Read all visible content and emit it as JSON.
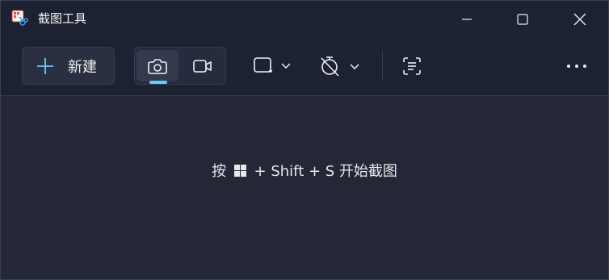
{
  "window": {
    "title": "截图工具"
  },
  "toolbar": {
    "new_label": "新建",
    "modes": [
      {
        "name": "screenshot-mode",
        "icon": "camera-icon",
        "active": true
      },
      {
        "name": "video-mode",
        "icon": "video-camera-icon",
        "active": false
      }
    ],
    "snip_shape_icon": "rectangle-snip-icon",
    "delay_icon": "timer-off-icon",
    "text_actions_icon": "text-scan-icon",
    "more_icon": "more-icon"
  },
  "content": {
    "hint_prefix": "按",
    "hint_suffix": "+ Shift + S 开始截图"
  },
  "colors": {
    "accent": "#60cdff",
    "background": "#232736",
    "titlebar": "#1d2233"
  }
}
